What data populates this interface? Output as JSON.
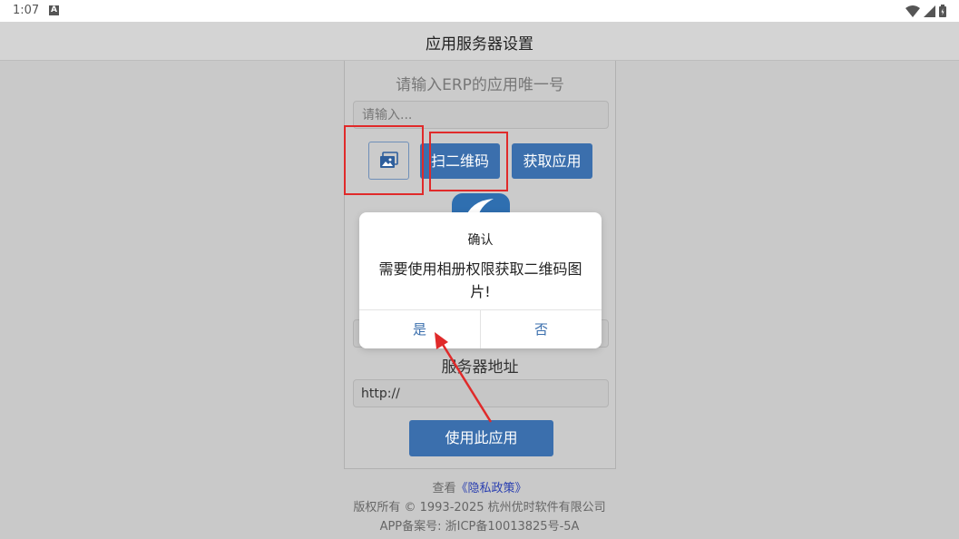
{
  "status_bar": {
    "time": "1:07",
    "badge": "A"
  },
  "header": {
    "title": "应用服务器设置"
  },
  "form": {
    "subheading": "请输入ERP的应用唯一号",
    "app_input_placeholder": "请输入...",
    "scan_button": "扫二维码",
    "fetch_button": "获取应用",
    "server_label": "服务器地址",
    "server_value": "http://",
    "use_button": "使用此应用"
  },
  "footer": {
    "view_prefix": "查看",
    "policy_link": "《隐私政策》",
    "copyright": "版权所有 © 1993-2025 杭州优时软件有限公司",
    "icp": "APP备案号: 浙ICP备10013825号-5A"
  },
  "dialog": {
    "title": "确认",
    "message": "需要使用相册权限获取二维码图片!",
    "yes": "是",
    "no": "否"
  },
  "colors": {
    "primary": "#3b6fad",
    "annotation": "#e02a2a",
    "link": "#2a3fb0"
  },
  "icons": [
    "wifi-icon",
    "signal-icon",
    "battery-icon",
    "gallery-icon"
  ]
}
